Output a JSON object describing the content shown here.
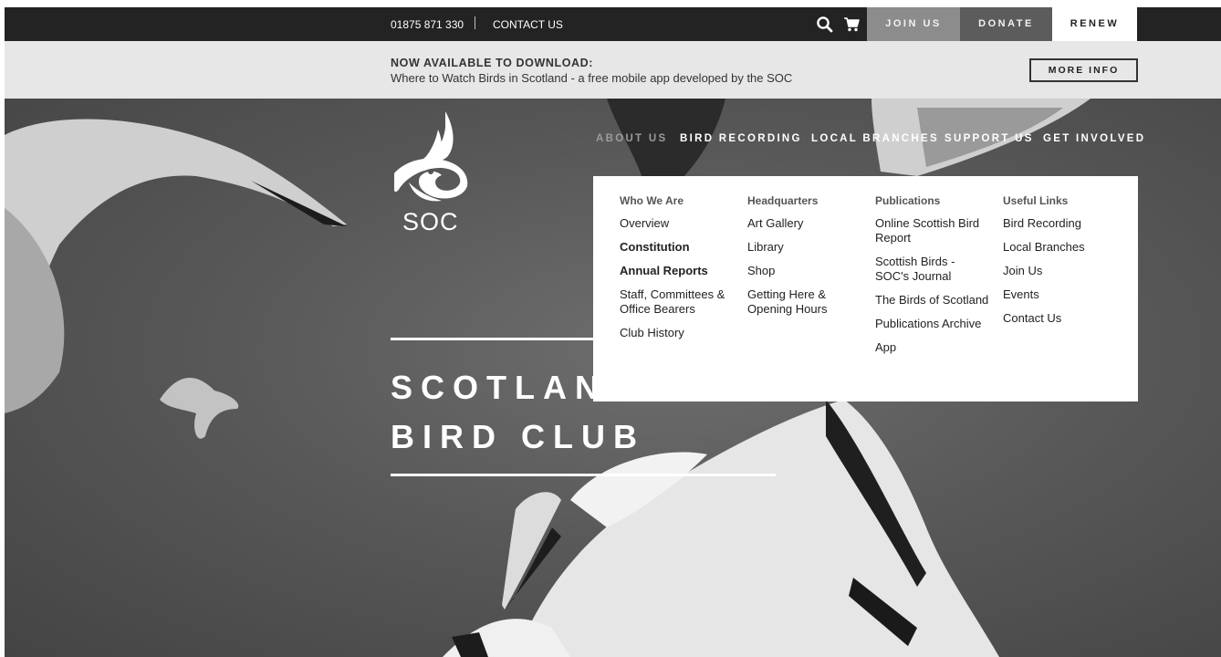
{
  "topbar": {
    "phone": "01875 871 330",
    "contact": "CONTACT US",
    "join": "JOIN US",
    "donate": "DONATE",
    "renew": "RENEW"
  },
  "announce": {
    "title": "NOW AVAILABLE TO DOWNLOAD:",
    "subtitle": "Where to Watch Birds in Scotland - a free mobile app developed by the SOC",
    "button": "MORE INFO"
  },
  "logo": {
    "text": "SOC"
  },
  "nav": {
    "about": "ABOUT US",
    "recording": "BIRD RECORDING",
    "branches": "LOCAL BRANCHES",
    "support": "SUPPORT US",
    "involved": "GET INVOLVED"
  },
  "hero": {
    "line1": "SCOTLAN",
    "line2": "BIRD CLUB"
  },
  "dropdown": {
    "columns": [
      {
        "heading": "Who We Are",
        "items": [
          "Overview",
          "Constitution",
          "Annual Reports",
          "Staff, Committees & Office Bearers",
          "Club History"
        ]
      },
      {
        "heading": "Headquarters",
        "items": [
          "Art Gallery",
          "Library",
          "Shop",
          "Getting Here & Opening Hours"
        ]
      },
      {
        "heading": "Publications",
        "items": [
          "Online Scottish Bird Report",
          "Scottish Birds - SOC's Journal",
          "The Birds of Scotland",
          "Publications Archive",
          "App"
        ]
      },
      {
        "heading": "Useful Links",
        "items": [
          "Bird Recording",
          "Local Branches",
          "Join Us",
          "Events",
          "Contact Us"
        ]
      }
    ]
  },
  "icons": {
    "search": "search-icon",
    "cart": "cart-icon",
    "cursor": "hand-pointer-icon"
  }
}
